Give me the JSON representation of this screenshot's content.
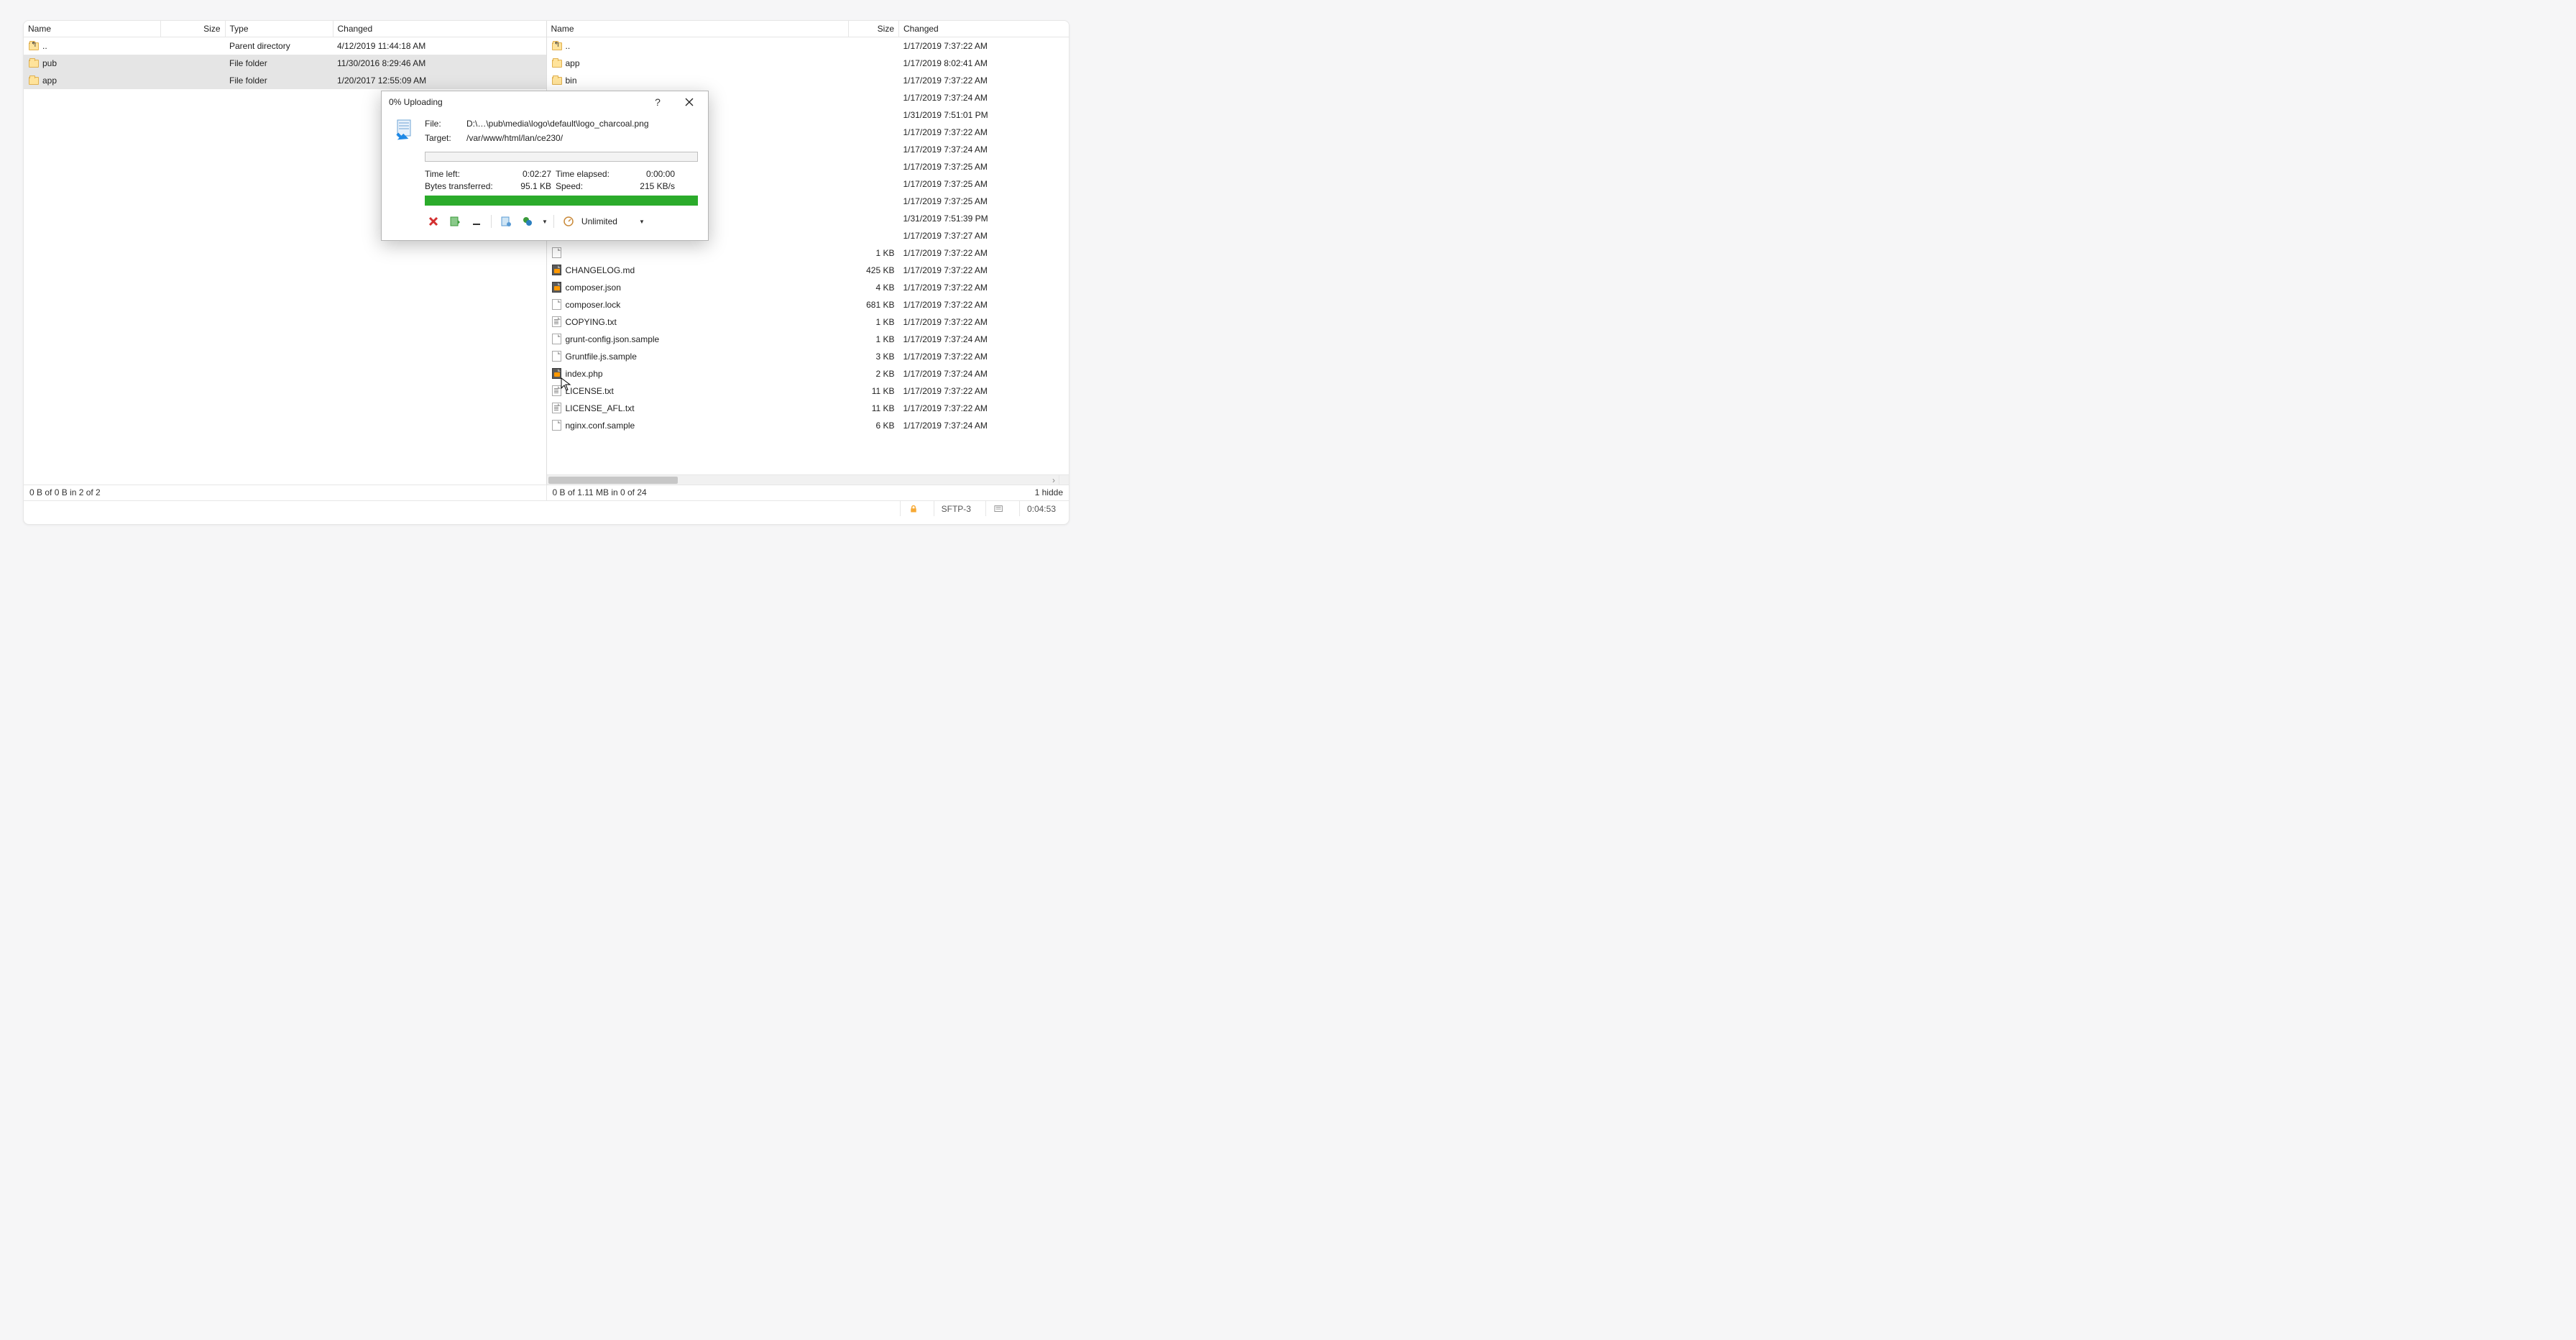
{
  "left": {
    "headers": [
      "Name",
      "Size",
      "Type",
      "Changed"
    ],
    "rows": [
      {
        "icon": "up",
        "name": "..",
        "size": "",
        "type": "Parent directory",
        "changed": "4/12/2019  11:44:18 AM"
      },
      {
        "icon": "folder",
        "name": "pub",
        "size": "",
        "type": "File folder",
        "changed": "11/30/2016  8:29:46 AM",
        "sel": true
      },
      {
        "icon": "folder",
        "name": "app",
        "size": "",
        "type": "File folder",
        "changed": "1/20/2017  12:55:09 AM",
        "sel": true
      }
    ],
    "status": "0 B of 0 B in 2 of 2",
    "status_right": ""
  },
  "right": {
    "headers": [
      "Name",
      "Size",
      "Changed"
    ],
    "rows": [
      {
        "icon": "up",
        "name": "..",
        "size": "",
        "changed": "1/17/2019 7:37:22 AM"
      },
      {
        "icon": "folder",
        "name": "app",
        "size": "",
        "changed": "1/17/2019 8:02:41 AM"
      },
      {
        "icon": "folder",
        "name": "bin",
        "size": "",
        "changed": "1/17/2019 7:37:22 AM"
      },
      {
        "icon": "folder",
        "name": "",
        "size": "",
        "changed": "1/17/2019 7:37:24 AM"
      },
      {
        "icon": "folder",
        "name": "",
        "size": "",
        "changed": "1/31/2019 7:51:01 PM"
      },
      {
        "icon": "folder",
        "name": "",
        "size": "",
        "changed": "1/17/2019 7:37:22 AM"
      },
      {
        "icon": "folder",
        "name": "",
        "size": "",
        "changed": "1/17/2019 7:37:24 AM"
      },
      {
        "icon": "folder",
        "name": "",
        "size": "",
        "changed": "1/17/2019 7:37:25 AM"
      },
      {
        "icon": "folder",
        "name": "",
        "size": "",
        "changed": "1/17/2019 7:37:25 AM"
      },
      {
        "icon": "folder",
        "name": "",
        "size": "",
        "changed": "1/17/2019 7:37:25 AM"
      },
      {
        "icon": "folder",
        "name": "",
        "size": "",
        "changed": "1/31/2019 7:51:39 PM"
      },
      {
        "icon": "folder",
        "name": "",
        "size": "",
        "changed": "1/17/2019 7:37:27 AM"
      },
      {
        "icon": "doc",
        "name": "",
        "size": "1 KB",
        "changed": "1/17/2019 7:37:22 AM"
      },
      {
        "icon": "subl",
        "name": "CHANGELOG.md",
        "size": "425 KB",
        "changed": "1/17/2019 7:37:22 AM"
      },
      {
        "icon": "subl",
        "name": "composer.json",
        "size": "4 KB",
        "changed": "1/17/2019 7:37:22 AM"
      },
      {
        "icon": "doc",
        "name": "composer.lock",
        "size": "681 KB",
        "changed": "1/17/2019 7:37:22 AM"
      },
      {
        "icon": "txt",
        "name": "COPYING.txt",
        "size": "1 KB",
        "changed": "1/17/2019 7:37:22 AM"
      },
      {
        "icon": "doc",
        "name": "grunt-config.json.sample",
        "size": "1 KB",
        "changed": "1/17/2019 7:37:24 AM"
      },
      {
        "icon": "doc",
        "name": "Gruntfile.js.sample",
        "size": "3 KB",
        "changed": "1/17/2019 7:37:22 AM"
      },
      {
        "icon": "subl",
        "name": "index.php",
        "size": "2 KB",
        "changed": "1/17/2019 7:37:24 AM"
      },
      {
        "icon": "txt",
        "name": "LICENSE.txt",
        "size": "11 KB",
        "changed": "1/17/2019 7:37:22 AM"
      },
      {
        "icon": "txt",
        "name": "LICENSE_AFL.txt",
        "size": "11 KB",
        "changed": "1/17/2019 7:37:22 AM"
      },
      {
        "icon": "doc",
        "name": "nginx.conf.sample",
        "size": "6 KB",
        "changed": "1/17/2019 7:37:24 AM"
      }
    ],
    "status": "0 B of 1.11 MB in 0 of 24",
    "status_right": "1 hidde"
  },
  "footer": {
    "proto": "SFTP-3",
    "time": "0:04:53"
  },
  "dialog": {
    "title": "0% Uploading",
    "file_label": "File:",
    "file_value": "D:\\…\\pub\\media\\logo\\default\\logo_charcoal.png",
    "target_label": "Target:",
    "target_value": "/var/www/html/lan/ce230/",
    "time_left_label": "Time left:",
    "time_left": "0:02:27",
    "time_elapsed_label": "Time elapsed:",
    "time_elapsed": "0:00:00",
    "bytes_label": "Bytes transferred:",
    "bytes": "95.1 KB",
    "speed_label": "Speed:",
    "speed": "215 KB/s",
    "unlimited": "Unlimited"
  }
}
